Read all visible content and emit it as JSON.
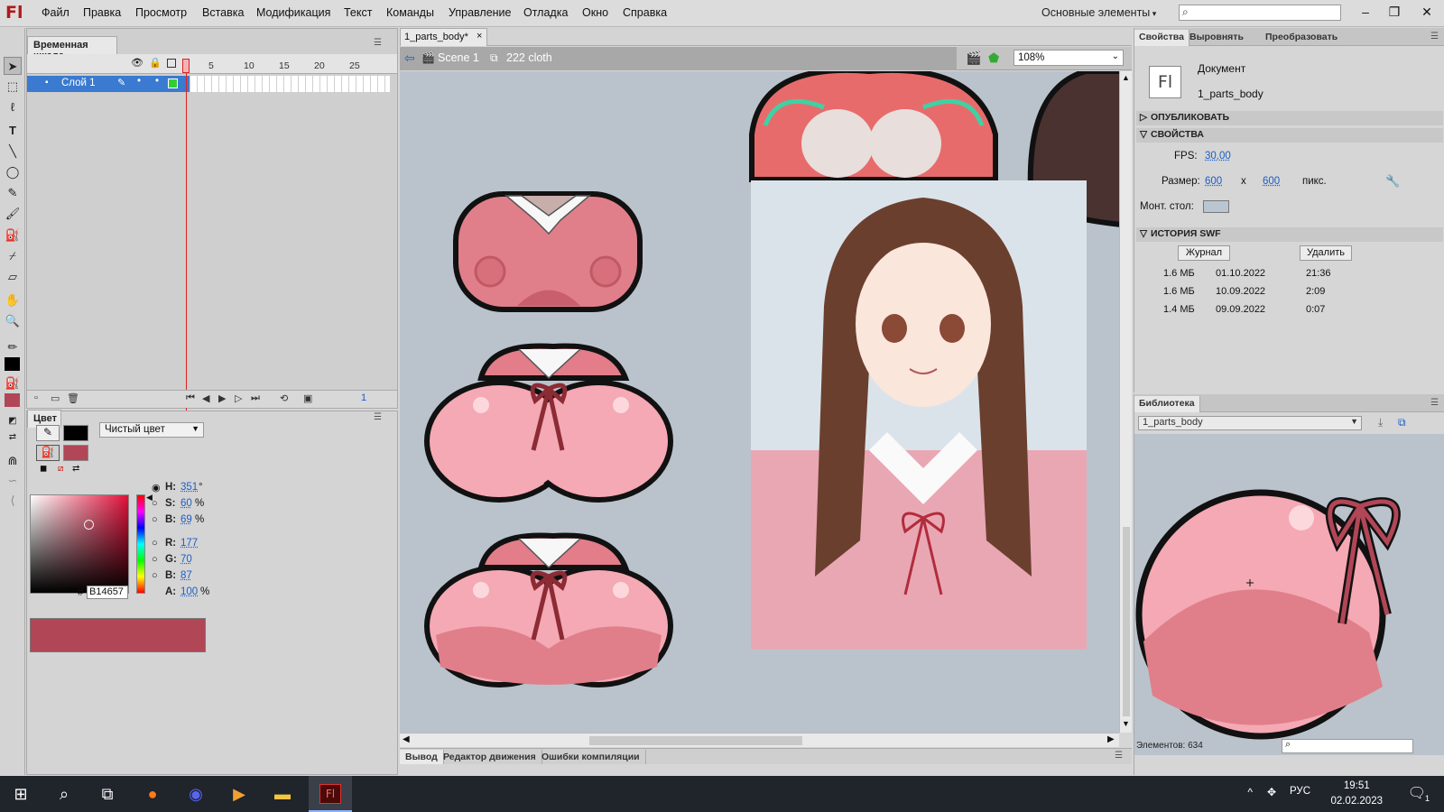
{
  "app": {
    "logo": "Fl",
    "workspace": "Основные элементы"
  },
  "menu": [
    "Файл",
    "Правка",
    "Просмотр",
    "Вставка",
    "Модификация",
    "Текст",
    "Команды",
    "Управление",
    "Отладка",
    "Окно",
    "Справка"
  ],
  "window_controls": {
    "minimize": "–",
    "restore": "❐",
    "close": "✕"
  },
  "timeline": {
    "title": "Временная шкала",
    "ruler": [
      "1",
      "5",
      "10",
      "15",
      "20",
      "25"
    ],
    "layer_name": "Слой 1",
    "current_frame": "1"
  },
  "color_panel": {
    "title": "Цвет",
    "fill_type": "Чистый цвет",
    "labels": {
      "h": "H:",
      "s": "S:",
      "b": "B:",
      "r": "R:",
      "g": "G:",
      "b2": "B:",
      "a": "A:",
      "hash": "#"
    },
    "h": "351",
    "h_unit": "°",
    "s": "60",
    "s_unit": "%",
    "b": "69",
    "b_unit": "%",
    "r": "177",
    "g": "70",
    "b2": "87",
    "a": "100",
    "a_unit": "%",
    "hex": "B14657",
    "swatch_color": "#b14657",
    "stroke_color": "#000000"
  },
  "document": {
    "tab_label": "1_parts_body*",
    "tab_close": "×",
    "scene": "Scene 1",
    "symbol": "222 cloth",
    "zoom": "108%"
  },
  "output_tabs": [
    "Вывод",
    "Редактор движения",
    "Ошибки компиляции"
  ],
  "properties": {
    "tabs": [
      "Свойства",
      "Выровнять",
      "Преобразовать"
    ],
    "doc_icon": "Fl",
    "doc_type": "Документ",
    "doc_name": "1_parts_body",
    "publish_header": "ОПУБЛИКОВАТЬ",
    "props_header": "СВОЙСТВА",
    "fps_label": "FPS:",
    "fps": "30,00",
    "size_label": "Размер:",
    "width": "600",
    "x": "x",
    "height": "600",
    "px": "пикс.",
    "stage_label": "Монт. стол:",
    "stage_color": "#b9c6d2",
    "history_header": "ИСТОРИЯ SWF",
    "journal_btn": "Журнал",
    "delete_btn": "Удалить",
    "history": [
      {
        "size": "1.6 МБ",
        "date": "01.10.2022",
        "time": "21:36"
      },
      {
        "size": "1.6 МБ",
        "date": "10.09.2022",
        "time": "2:09"
      },
      {
        "size": "1.4 МБ",
        "date": "09.09.2022",
        "time": "0:07"
      }
    ]
  },
  "library": {
    "title": "Библиотека",
    "doc_select": "1_parts_body",
    "count": "Элементов: 634"
  },
  "taskbar": {
    "lang": "РУС",
    "time": "19:51",
    "date": "02.02.2023",
    "notification_badge": "1"
  }
}
